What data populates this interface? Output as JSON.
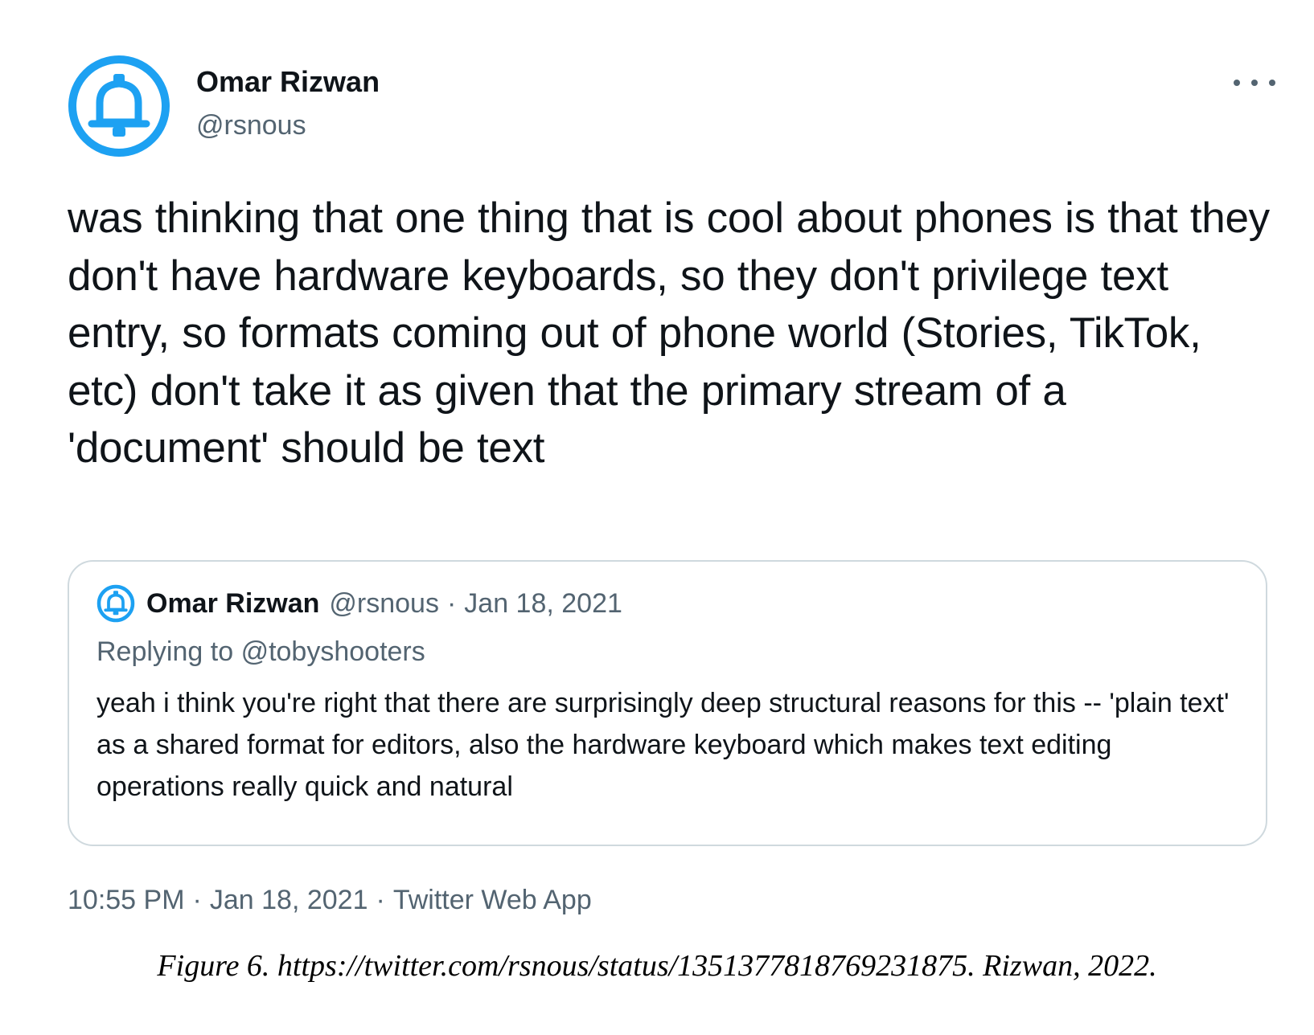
{
  "colors": {
    "accent": "#1d9bf0",
    "text_primary": "#0f1419",
    "text_secondary": "#536471",
    "card_border": "#cfd9de",
    "avatar_ring": "#1da1f2"
  },
  "tweet": {
    "author": {
      "name": "Omar Rizwan",
      "handle": "@rsnous",
      "avatar_icon": "bell-icon"
    },
    "more_icon": "more-dots-icon",
    "text": "was thinking that one thing that is cool about phones is that they don't have hardware keyboards, so they don't privilege text entry, so formats coming out of phone world (Stories, TikTok, etc) don't take it as given that the primary stream of a 'document' should be text",
    "quoted": {
      "author_name": "Omar Rizwan",
      "handle": "@rsnous",
      "separator": "·",
      "date": "Jan 18, 2021",
      "replying_prefix": "Replying to",
      "replying_to": "@tobyshooters",
      "text": "yeah i think you're right that there are surprisingly deep structural reasons for this -- 'plain text' as a shared format for editors, also the hardware keyboard which makes text editing operations really quick and natural"
    },
    "meta": {
      "time": "10:55 PM",
      "date": "Jan 18, 2021",
      "source": "Twitter Web App",
      "separator": "·"
    }
  },
  "caption": "Figure 6. https://twitter.com/rsnous/status/1351377818769231875. Rizwan, 2022."
}
